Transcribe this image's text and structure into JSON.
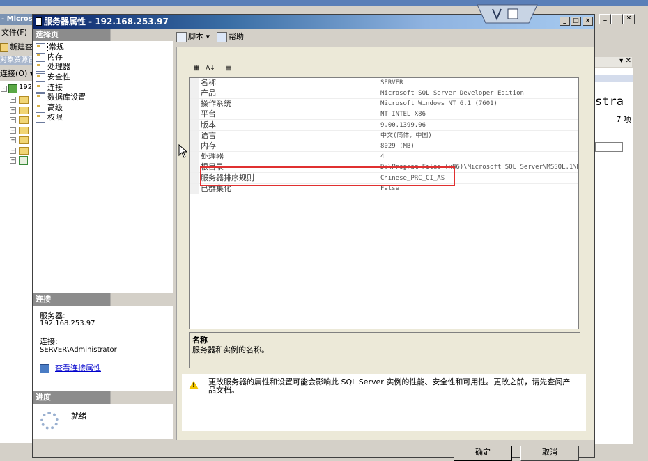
{
  "background": {
    "app_title": "- Micros",
    "menu_file": "文件(F)",
    "new_query": "新建查",
    "object_explorer_title": "对象资源管",
    "connect_label": "连接(O) ▾",
    "tree_root": "192",
    "right_pane_text": "stra",
    "right_pane_count": "7 项",
    "right_pin": "▾ ✕"
  },
  "dialog": {
    "title": "服务器属性 - 192.168.253.97",
    "min_glyph": "_",
    "max_glyph": "□",
    "close_glyph": "×"
  },
  "left_pane": {
    "select_page_header": "选择页",
    "pages": [
      {
        "label": "常规",
        "selected": true
      },
      {
        "label": "内存"
      },
      {
        "label": "处理器"
      },
      {
        "label": "安全性"
      },
      {
        "label": "连接"
      },
      {
        "label": "数据库设置"
      },
      {
        "label": "高级"
      },
      {
        "label": "权限"
      }
    ],
    "connection_header": "连接",
    "server_label": "服务器:",
    "server_value": "192.168.253.97",
    "connection_label": "连接:",
    "connection_value": "SERVER\\Administrator",
    "view_connection_properties": "查看连接属性",
    "progress_header": "进度",
    "progress_status": "就绪"
  },
  "toolbar": {
    "script_label": "脚本 ▾",
    "help_label": "帮助"
  },
  "grid_toolbar": {
    "categorized_glyph": "▦",
    "alphabetical_glyph": "A↓",
    "property_pages_glyph": "▤"
  },
  "properties": [
    {
      "name": "名称",
      "value": "SERVER"
    },
    {
      "name": "产品",
      "value": "Microsoft SQL Server Developer Edition"
    },
    {
      "name": "操作系统",
      "value": "Microsoft Windows NT 6.1 (7601)"
    },
    {
      "name": "平台",
      "value": "NT INTEL X86"
    },
    {
      "name": "版本",
      "value": "9.00.1399.06"
    },
    {
      "name": "语言",
      "value": "中文(简体，中国)"
    },
    {
      "name": "内存",
      "value": "8029 (MB)"
    },
    {
      "name": "处理器",
      "value": "4"
    },
    {
      "name": "根目录",
      "value": "D:\\Program Files (x86)\\Microsoft SQL Server\\MSSQL.1\\M"
    },
    {
      "name": "服务器排序规则",
      "value": "Chinese_PRC_CI_AS"
    },
    {
      "name": "已群集化",
      "value": "False"
    }
  ],
  "description": {
    "title": "名称",
    "text": "服务器和实例的名称。"
  },
  "warning": {
    "text": "更改服务器的属性和设置可能会影响此 SQL Server 实例的性能、安全性和可用性。更改之前，请先查阅产品文档。"
  },
  "buttons": {
    "ok": "确定",
    "cancel": "取消"
  },
  "colors": {
    "highlight_border": "#e03030",
    "dialog_face": "#d4d0c8",
    "link": "#0000cc"
  }
}
